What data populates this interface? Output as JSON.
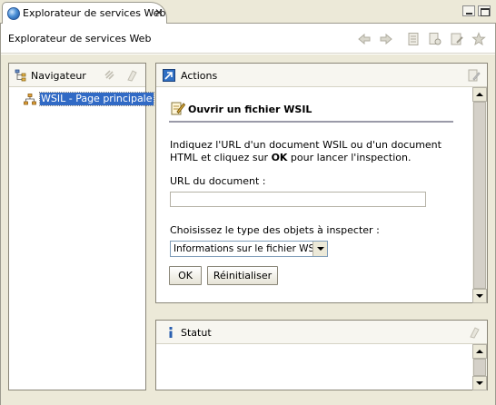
{
  "tab": {
    "title": "Explorateur de services Web"
  },
  "header": {
    "title": "Explorateur de services Web"
  },
  "navigator": {
    "title": "Navigateur",
    "tree": [
      {
        "label": "WSIL - Page principale",
        "selected": true
      }
    ]
  },
  "actions": {
    "title": "Actions",
    "form": {
      "heading": "Ouvrir un fichier WSIL",
      "desc_before": "Indiquez l'URL d'un document WSIL ou d'un document HTML et cliquez sur ",
      "desc_bold": "OK",
      "desc_after": " pour lancer l'inspection.",
      "url_label": "URL du document :",
      "url_value": "",
      "type_label": "Choisissez le type des objets à inspecter :",
      "type_selected": "Informations sur le fichier WSIL",
      "ok_label": "OK",
      "reset_label": "Réinitialiser"
    }
  },
  "status": {
    "title": "Statut"
  },
  "icons": {
    "tab": "globe-icon",
    "toolbar": [
      "back-arrow-icon",
      "forward-arrow-icon",
      "document-icon",
      "document-search-icon",
      "page-refresh-icon",
      "favorite-star-icon"
    ],
    "navigator": "navigator-tree-icon",
    "actions": "actions-arrow-icon",
    "status": "info-icon"
  },
  "colors": {
    "selection": "#316ac5",
    "panel_border": "#8a8678",
    "background": "#ece9d8"
  }
}
